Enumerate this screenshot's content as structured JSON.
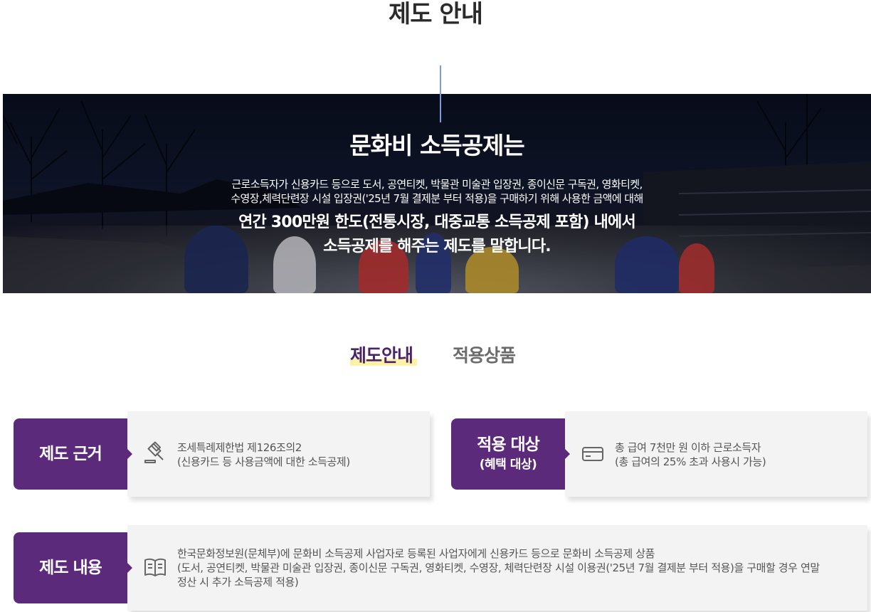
{
  "page": {
    "title": "제도 안내"
  },
  "hero": {
    "title": "문화비 소득공제는",
    "desc_line1": "근로소득자가 신용카드 등으로 도서, 공연티켓, 박물관 미술관 입장권, 종이신문 구독권, 영화티켓,",
    "desc_line2": "수영장,체력단련장 시설 입장권('25년 7월 결제분 부터 적용)을 구매하기 위해 사용한 금액에 대해",
    "emph_line1": "연간 300만원 한도(전통시장, 대중교통 소득공제 포함) 내에서",
    "emph_line2": "소득공제를 해주는 제도를 말합니다."
  },
  "tabs": [
    {
      "label": "제도안내",
      "active": true
    },
    {
      "label": "적용상품",
      "active": false
    }
  ],
  "cards": {
    "basis": {
      "title": "제도 근거",
      "icon": "gavel-icon",
      "line1": "조세특례제한법 제126조의2",
      "line2": "(신용카드 등 사용금액에 대한 소득공제)"
    },
    "target": {
      "title": "적용 대상",
      "subtitle": "(혜택 대상)",
      "icon": "credit-card-icon",
      "line1": "총 급여 7천만 원 이하 근로소득자",
      "line2": "(총 급여의 25% 초과 사용시 가능)"
    },
    "content": {
      "title": "제도 내용",
      "icon": "book-icon",
      "line1": "한국문화정보원(문체부)에 문화비 소득공제 사업자로 등록된 사업자에게 신용카드 등으로 문화비 소득공제 상품",
      "line2": "(도서, 공연티켓, 박물관 미술관 입장권, 종이신문 구독권, 영화티켓, 수영장, 체력단련장 시설 이용권('25년 7월 결제분 부터 적용)을 구매할 경우 연말",
      "line3": "정산 시 추가 소득공제 적용)"
    }
  },
  "colors": {
    "accent": "#5b2a7b",
    "highlight": "#fcf3a8",
    "card_bg": "#f3f3f3"
  }
}
